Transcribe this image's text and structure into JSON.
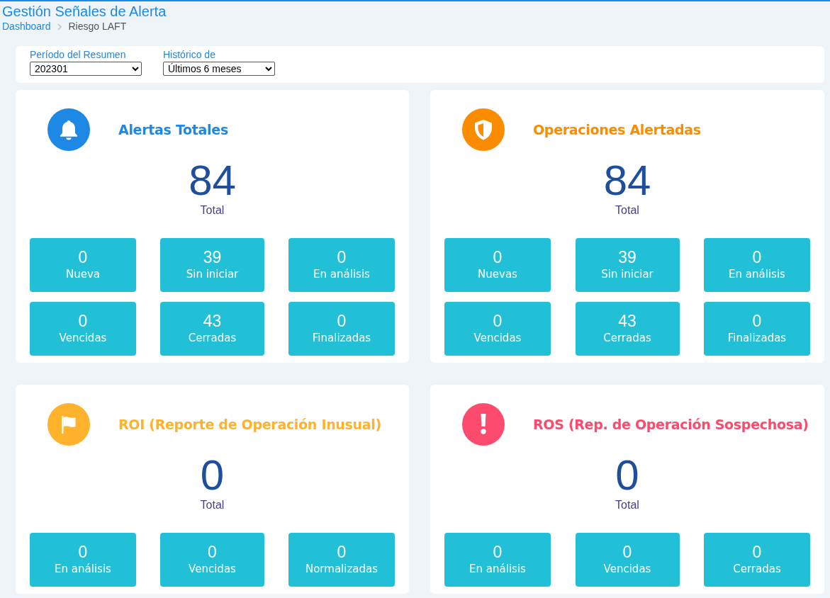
{
  "page_title": "Gestión Señales de Alerta",
  "breadcrumb": [
    "Dashboard",
    "Riesgo LAFT"
  ],
  "filters": [
    {
      "label": "Período del Resumen",
      "value": "202301"
    },
    {
      "label": "Histórico de",
      "value": "Últimos 6 meses"
    }
  ],
  "cards": [
    {
      "title": "Alertas Totales",
      "kind": "bell",
      "color": "#1e88e5",
      "total": "84",
      "total_label": "Total",
      "tiles": [
        {
          "value": "0",
          "label": "Nueva"
        },
        {
          "value": "39",
          "label": "Sin iniciar"
        },
        {
          "value": "0",
          "label": "En análisis"
        },
        {
          "value": "0",
          "label": "Vencidas"
        },
        {
          "value": "43",
          "label": "Cerradas"
        },
        {
          "value": "0",
          "label": "Finalizadas"
        }
      ]
    },
    {
      "title": "Operaciones Alertadas",
      "kind": "shield",
      "color": "#fb8c00",
      "total": "84",
      "total_label": "Total",
      "tiles": [
        {
          "value": "0",
          "label": "Nuevas"
        },
        {
          "value": "39",
          "label": "Sin iniciar"
        },
        {
          "value": "0",
          "label": "En análisis"
        },
        {
          "value": "0",
          "label": "Vencidas"
        },
        {
          "value": "43",
          "label": "Cerradas"
        },
        {
          "value": "0",
          "label": "Finalizadas"
        }
      ]
    },
    {
      "title": "ROI (Reporte de Operación Inusual)",
      "kind": "flag",
      "color": "#ffb22b",
      "total": "0",
      "total_label": "Total",
      "tiles": [
        {
          "value": "0",
          "label": "En análisis"
        },
        {
          "value": "0",
          "label": "Vencidas"
        },
        {
          "value": "0",
          "label": "Normalizadas"
        }
      ]
    },
    {
      "title": "ROS (Rep. de Operación Sospechosa)",
      "kind": "exclamation",
      "color": "#fc4b6c",
      "total": "0",
      "total_label": "Total",
      "tiles": [
        {
          "value": "0",
          "label": "En análisis"
        },
        {
          "value": "0",
          "label": "Vencidas"
        },
        {
          "value": "0",
          "label": "Cerradas"
        }
      ]
    }
  ]
}
